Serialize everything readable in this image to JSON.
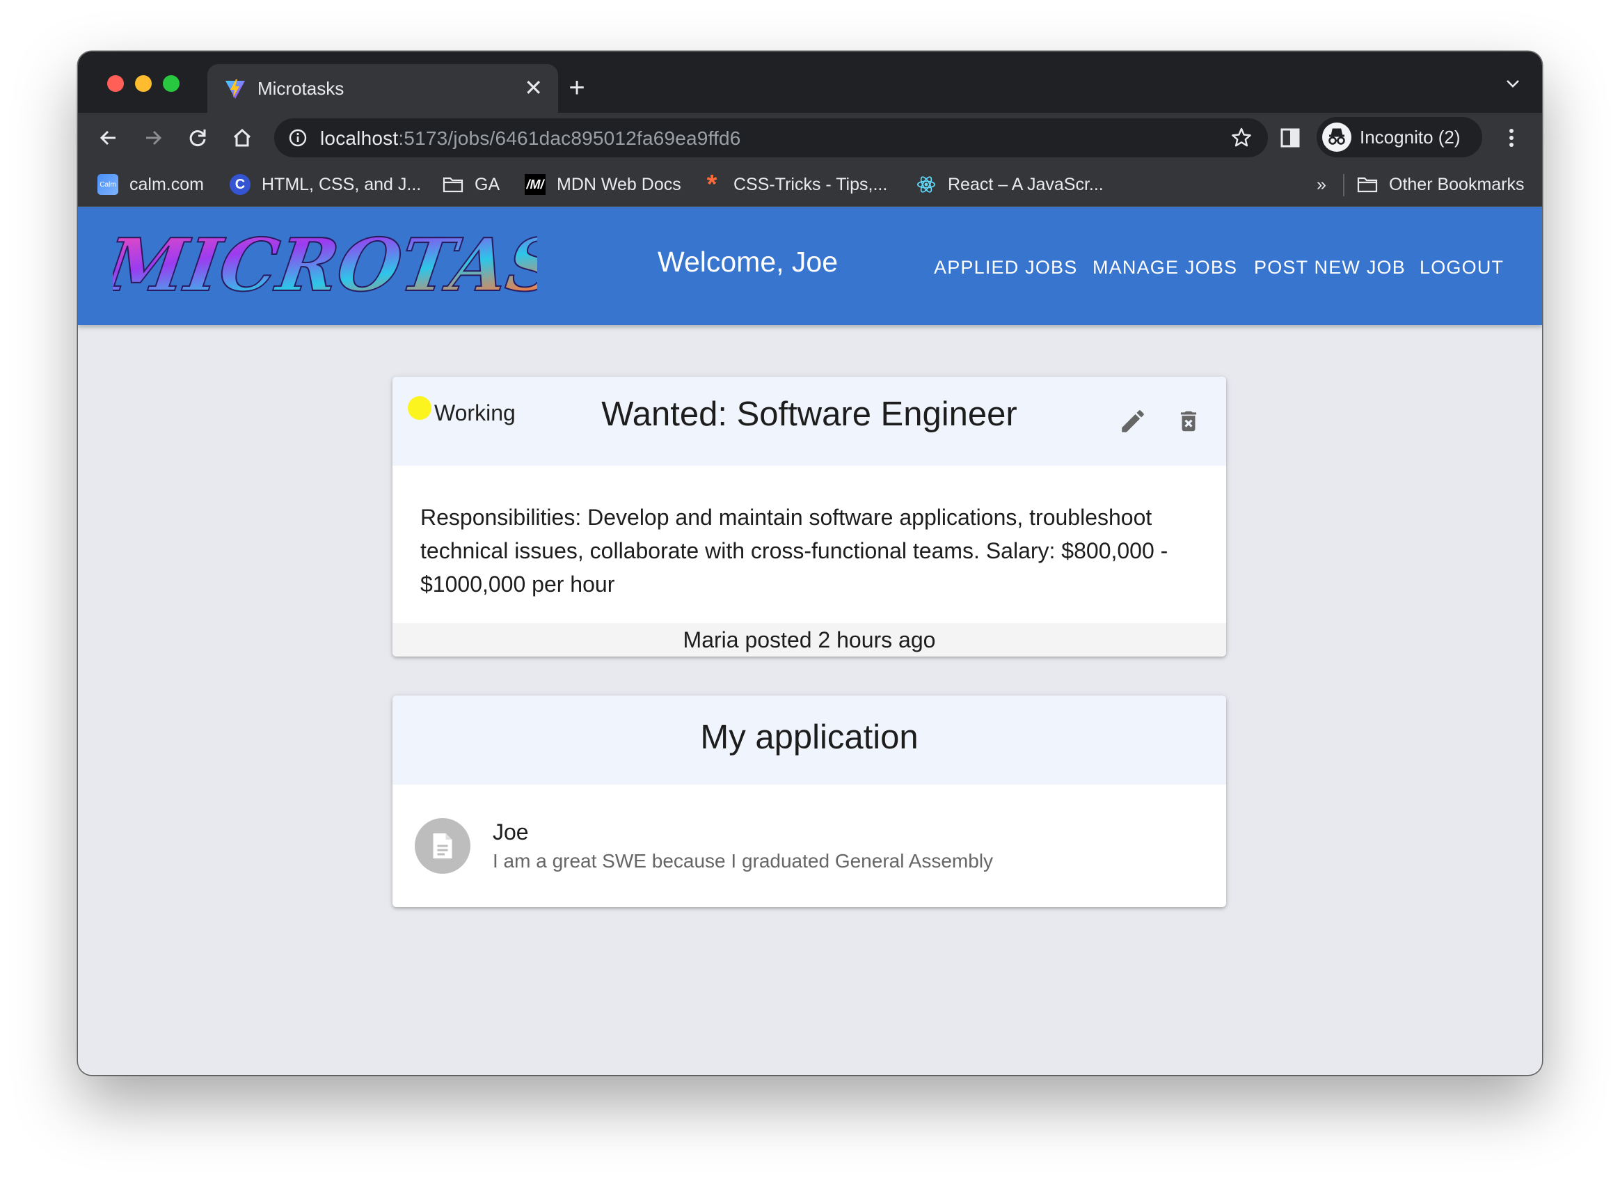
{
  "browser": {
    "tab_title": "Microtasks",
    "tab_close": "✕",
    "new_tab": "+",
    "url_host": "localhost",
    "url_path": ":5173/jobs/6461dac895012fa69ea9ffd6",
    "profile_label": "Incognito (2)",
    "bookmarks": [
      {
        "label": "calm.com",
        "icon": "calm-icon"
      },
      {
        "label": "HTML, CSS, and J...",
        "icon": "c-icon"
      },
      {
        "label": "GA",
        "icon": "folder-icon"
      },
      {
        "label": "MDN Web Docs",
        "icon": "mdn-icon"
      },
      {
        "label": "CSS-Tricks - Tips,...",
        "icon": "asterisk-icon"
      },
      {
        "label": "React – A JavaScr...",
        "icon": "react-icon"
      }
    ],
    "bookmarks_overflow": "»",
    "other_bookmarks": "Other Bookmarks"
  },
  "app": {
    "logo_text": "MICROTASKS",
    "welcome": "Welcome, Joe",
    "nav": [
      "APPLIED JOBS",
      "MANAGE JOBS",
      "POST NEW JOB",
      "LOGOUT"
    ],
    "accent_color": "#3875cf"
  },
  "job": {
    "status": "Working",
    "status_color": "#fbf41f",
    "title": "Wanted: Software Engineer",
    "description": "Responsibilities: Develop and maintain software applications, troubleshoot technical issues, collaborate with cross-functional teams. Salary: $800,000 - $1000,000 per hour",
    "footer": "Maria posted 2 hours ago"
  },
  "application": {
    "heading": "My application",
    "applicant": "Joe",
    "message": "I am a great SWE because I graduated General Assembly"
  }
}
